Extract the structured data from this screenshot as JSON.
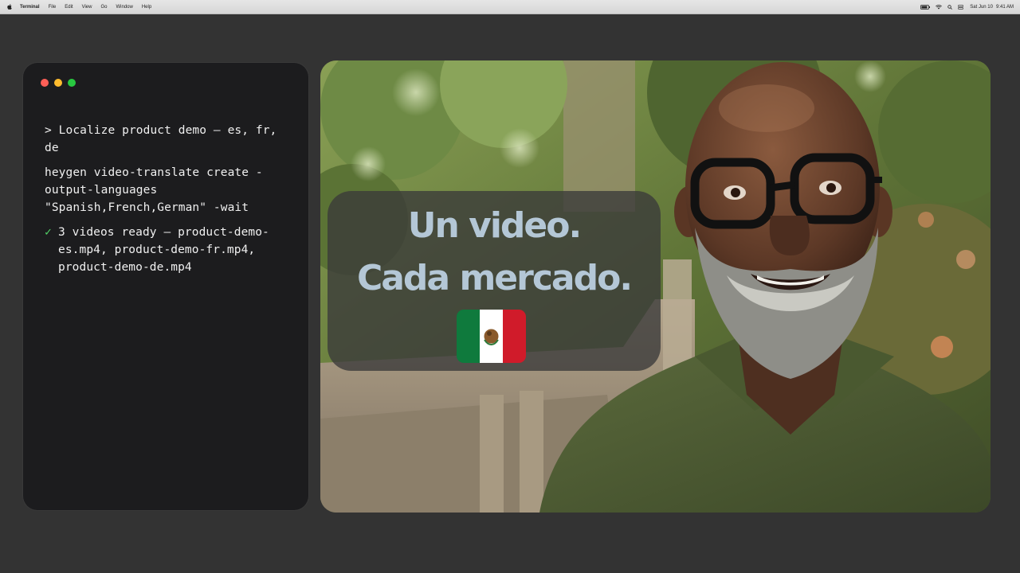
{
  "menubar": {
    "app_name": "Terminal",
    "menus": [
      "File",
      "Edit",
      "View",
      "Go",
      "Window",
      "Help"
    ],
    "date": "Sat Jun 10",
    "time": "9:41 AM",
    "icons": [
      "apple-icon",
      "battery-icon",
      "wifi-icon",
      "search-icon",
      "control-center-icon"
    ]
  },
  "terminal": {
    "prompt_line": "> Localize product demo — es, fr, de",
    "command": "heygen video-translate create -output-languages \"Spanish,French,German\" -wait",
    "result_check": "✓",
    "result": "3 videos ready — product-demo-es.mp4, product-demo-fr.mp4, product-demo-de.mp4",
    "colors": {
      "check": "#53d769",
      "text": "#f0f0f0",
      "background": "#1c1c1e"
    }
  },
  "video": {
    "caption_line1": "Un video.",
    "caption_line2": "Cada mercado.",
    "flag": "mexico-flag-icon",
    "colors": {
      "caption": "#b4c7d6"
    }
  }
}
